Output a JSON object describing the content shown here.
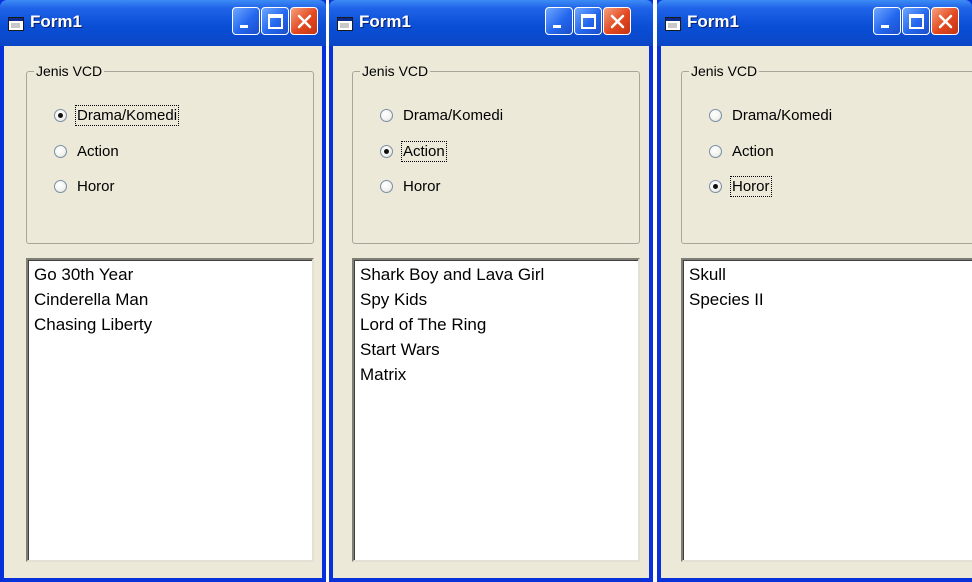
{
  "windows": [
    {
      "title": "Form1",
      "group_caption": "Jenis VCD",
      "radios": [
        {
          "label": "Drama/Komedi",
          "checked": true
        },
        {
          "label": "Action",
          "checked": false
        },
        {
          "label": "Horor",
          "checked": false
        }
      ],
      "list_items": [
        "Go 30th Year",
        "Cinderella Man",
        "Chasing Liberty"
      ]
    },
    {
      "title": "Form1",
      "group_caption": "Jenis VCD",
      "radios": [
        {
          "label": "Drama/Komedi",
          "checked": false
        },
        {
          "label": "Action",
          "checked": true
        },
        {
          "label": "Horor",
          "checked": false
        }
      ],
      "list_items": [
        "Shark Boy and Lava Girl",
        "Spy Kids",
        "Lord of The Ring",
        "Start Wars",
        "Matrix"
      ]
    },
    {
      "title": "Form1",
      "group_caption": "Jenis VCD",
      "radios": [
        {
          "label": "Drama/Komedi",
          "checked": false
        },
        {
          "label": "Action",
          "checked": false
        },
        {
          "label": "Horor",
          "checked": true
        }
      ],
      "list_items": [
        "Skull",
        "Species II"
      ]
    }
  ],
  "icons": {
    "app": "form-app-icon",
    "minimize": "minimize-icon",
    "maximize": "maximize-icon",
    "close": "close-icon"
  },
  "colors": {
    "titlebar": "#0a4fd6",
    "client": "#ece9d8",
    "close_button": "#e2481f"
  }
}
